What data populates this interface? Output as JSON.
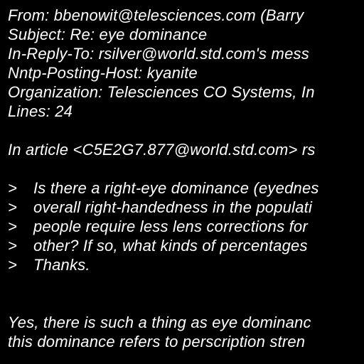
{
  "background": "#000000",
  "text_color": "#ffffff",
  "headers": {
    "from": "From: bbenowit@telesciences.com (Barry",
    "subject": "Subject: Re: eye dominance",
    "in_reply_to": "In-Reply-To: rsilver@world.std.com's mess",
    "nntp_posting_host": "Nntp-Posting-Host: kyanite",
    "organization": "Organization: Telesciences CO Systems, In",
    "lines": "Lines: 24"
  },
  "attribution": "In article <C5E2G7.877@world.std.com> rs",
  "quote_marker": ">",
  "quoted_lines": [
    "Is there a right-eye dominance (eyednes",
    "overall right-handedness in the populati",
    "people require less lens corrections for",
    "other? If so, what kinds of percentages",
    "Thanks."
  ],
  "reply_lines": [
    "Yes, there is such a thing as eye dominanc",
    "this dominance refers to perscription stren"
  ]
}
